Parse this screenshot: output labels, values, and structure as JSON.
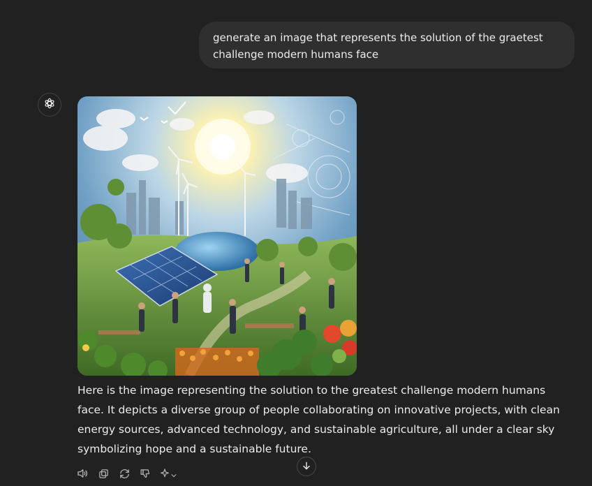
{
  "conversation": {
    "user_message": "generate an image that represents the solution of the graetest challenge modern humans face",
    "assistant": {
      "avatar_icon": "openai-logo-icon",
      "image_subject": "sustainable future scene",
      "response_text": "Here is the image representing the solution to the greatest challenge modern humans face. It depicts a diverse group of people collaborating on innovative projects, with clean energy sources, advanced technology, and sustainable agriculture, all under a clear sky symbolizing hope and a sustainable future."
    }
  },
  "actions": [
    {
      "name": "read-aloud",
      "icon": "speaker-icon"
    },
    {
      "name": "copy",
      "icon": "copy-icon"
    },
    {
      "name": "regenerate",
      "icon": "refresh-icon"
    },
    {
      "name": "bad-response",
      "icon": "thumbs-down-icon"
    },
    {
      "name": "change-model",
      "icon": "sparkle-icon"
    }
  ],
  "scroll_button": {
    "icon": "arrow-down-icon"
  },
  "colors": {
    "background": "#212121",
    "user_bubble": "#2f2f2f",
    "text": "#ececec",
    "icon": "#b4b4b4"
  }
}
